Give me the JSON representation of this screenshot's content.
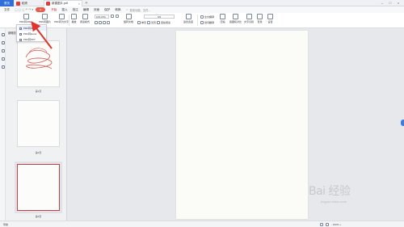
{
  "titlebar": {
    "home": "首页",
    "tab1": "稻壳",
    "tab2": "新建图片.pdf"
  },
  "menu": {
    "file": "文件",
    "items": [
      "开始",
      "插入",
      "批注",
      "编辑",
      "页面",
      "保护",
      "转换"
    ],
    "search": "查找功能、文件..."
  },
  "toolbar": {
    "pdf_to_office": "PDF转Office",
    "pdf_to_image": "PDF转图片",
    "pdf_to_text": "PDF转为文字",
    "play": "播放",
    "print_preview": "阅读模式",
    "zoom": "103.47%",
    "rotate": "旋转文档",
    "single_page": "单页",
    "double_page": "双页",
    "continuous": "连续阅读",
    "fit_width": "适合宽度",
    "page_indicator": "3/3",
    "bg": "背景",
    "full_trans": "全文翻译",
    "translate": "划词翻译",
    "compress": "压缩",
    "screenshot": "截图和对比",
    "ocr": "文字识别",
    "find": "查找",
    "settings": "设置"
  },
  "panel": {
    "title": "缩略图",
    "thumbs": [
      {
        "label": "第1页"
      },
      {
        "label": "第2页"
      },
      {
        "label": "第3页"
      }
    ]
  },
  "dropdown": {
    "items": [
      "PDF转Word",
      "PDF转Excel",
      "PDF转PPT"
    ]
  },
  "watermark": {
    "main": "Bai 经验",
    "sub": "jingyan.baidu.com"
  },
  "status": {
    "left": "导航",
    "right": "- 100% +"
  },
  "colors": {
    "accent": "#2f6fdc",
    "arrow": "#e0342c"
  }
}
